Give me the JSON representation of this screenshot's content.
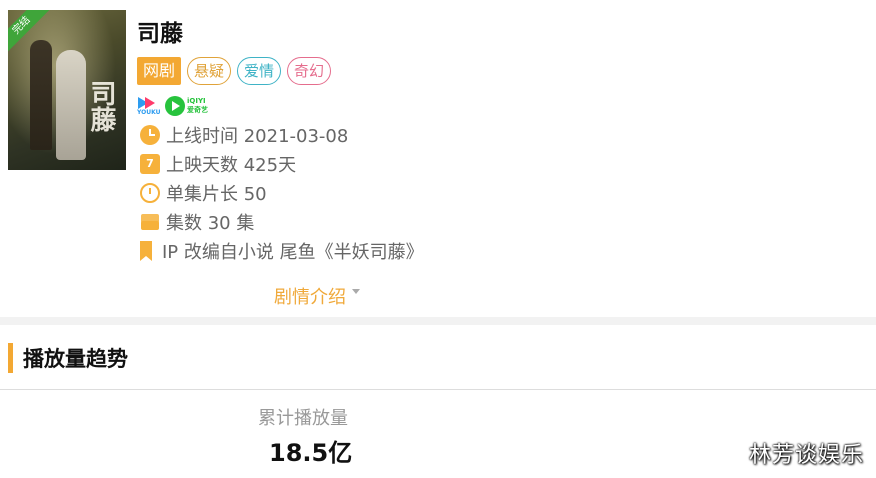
{
  "show": {
    "title": "司藤",
    "poster_badge": "完结",
    "poster_calligraphy": "司藤",
    "type_tag": "网剧",
    "genre_tags": [
      "悬疑",
      "爱情",
      "奇幻"
    ],
    "platforms": [
      {
        "name": "YOUKU",
        "icon": "youku-logo"
      },
      {
        "name": "爱奇艺",
        "extra": "iQIYI",
        "icon": "iqiyi-logo"
      }
    ],
    "info": [
      {
        "icon": "clock-icon",
        "text": "上线时间 2021-03-08"
      },
      {
        "icon": "calendar-icon",
        "icon_text": "7",
        "text": "上映天数 425天"
      },
      {
        "icon": "timer-icon",
        "text": "单集片长 50"
      },
      {
        "icon": "layers-icon",
        "text": "集数 30 集"
      },
      {
        "icon": "bookmark-icon",
        "text": "IP 改编自小说 尾鱼《半妖司藤》"
      }
    ],
    "synopsis_link": "剧情介绍"
  },
  "trend": {
    "section_title": "播放量趋势",
    "stat_label": "累计播放量",
    "stat_value": "18.5亿"
  },
  "watermark": "林芳谈娱乐",
  "colors": {
    "accent": "#f3a833",
    "tag_suspense": "#e0a33a",
    "tag_romance": "#3fb3c6",
    "tag_fantasy": "#e56d8d",
    "badge_green": "#3fa53a"
  }
}
